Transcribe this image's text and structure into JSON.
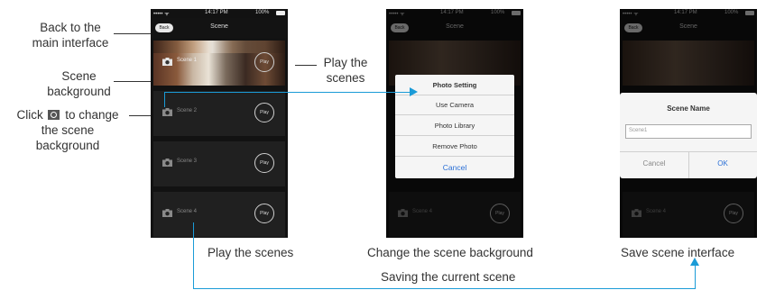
{
  "phones": {
    "status": {
      "signal": "••••• ᯤ",
      "time": "14:17 PM",
      "battery": "100%"
    },
    "nav": {
      "back": "Back",
      "title": "Scene"
    },
    "scene_rows": [
      {
        "name": "Scene 1",
        "play": "Play"
      },
      {
        "name": "Scene 2",
        "play": "Play"
      },
      {
        "name": "Scene 3",
        "play": "Play"
      },
      {
        "name": "Scene 4",
        "play": "Play"
      }
    ],
    "photo_setting": {
      "title": "Photo Setting",
      "options": [
        "Use Camera",
        "Photo Library",
        "Remove Photo"
      ],
      "cancel": "Cancel"
    },
    "scene_name_dialog": {
      "title": "Scene Name",
      "input_value": "Scene1",
      "cancel": "Cancel",
      "ok": "OK"
    }
  },
  "annotations": {
    "back_line1": "Back to the",
    "back_line2": "main interface",
    "bg_line1": "Scene",
    "bg_line2": "background",
    "click_pre": "Click",
    "click_post": "to change",
    "click_line2": "the scene",
    "click_line3": "background",
    "play_line1": "Play the",
    "play_line2": "scenes"
  },
  "captions": {
    "phone1": "Play the scenes",
    "phone2": "Change the scene background",
    "phone3": "Save scene interface",
    "flow": "Saving the current scene"
  },
  "colors": {
    "accent": "#1a9bd7",
    "ok_blue": "#2a6fd6"
  }
}
